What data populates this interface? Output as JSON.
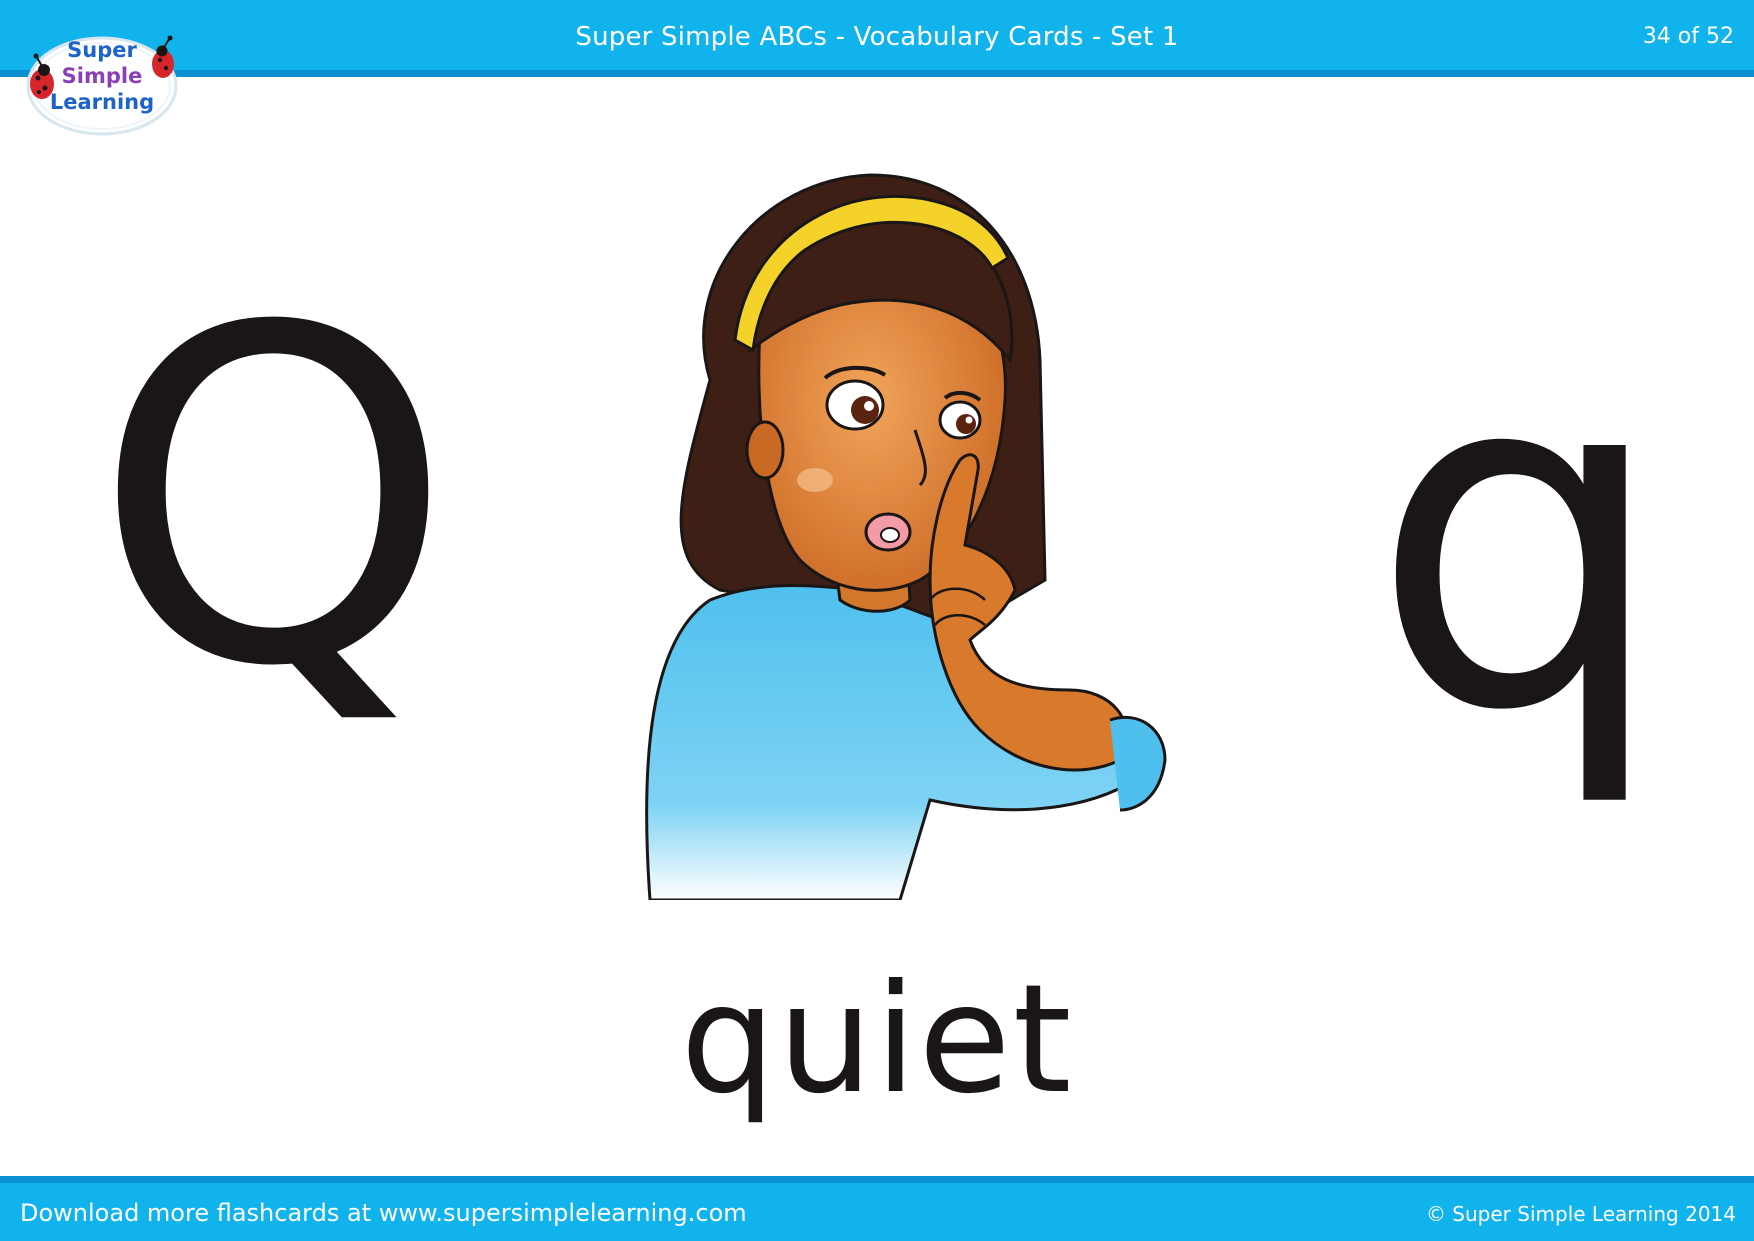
{
  "header": {
    "title": "Super Simple ABCs - Vocabulary Cards - Set 1",
    "page_count": "34 of 52"
  },
  "logo": {
    "line1": "Super",
    "line2": "Simple",
    "line3": "Learning"
  },
  "card": {
    "uppercase_letter": "Q",
    "lowercase_letter": "q",
    "word": "quiet",
    "illustration": "girl-saying-shh-icon"
  },
  "footer": {
    "download_text": "Download more flashcards at www.supersimplelearning.com",
    "copyright": "© Super Simple Learning 2014"
  },
  "colors": {
    "header_blue": "#10b3ec",
    "letter_black": "#1a1616"
  }
}
